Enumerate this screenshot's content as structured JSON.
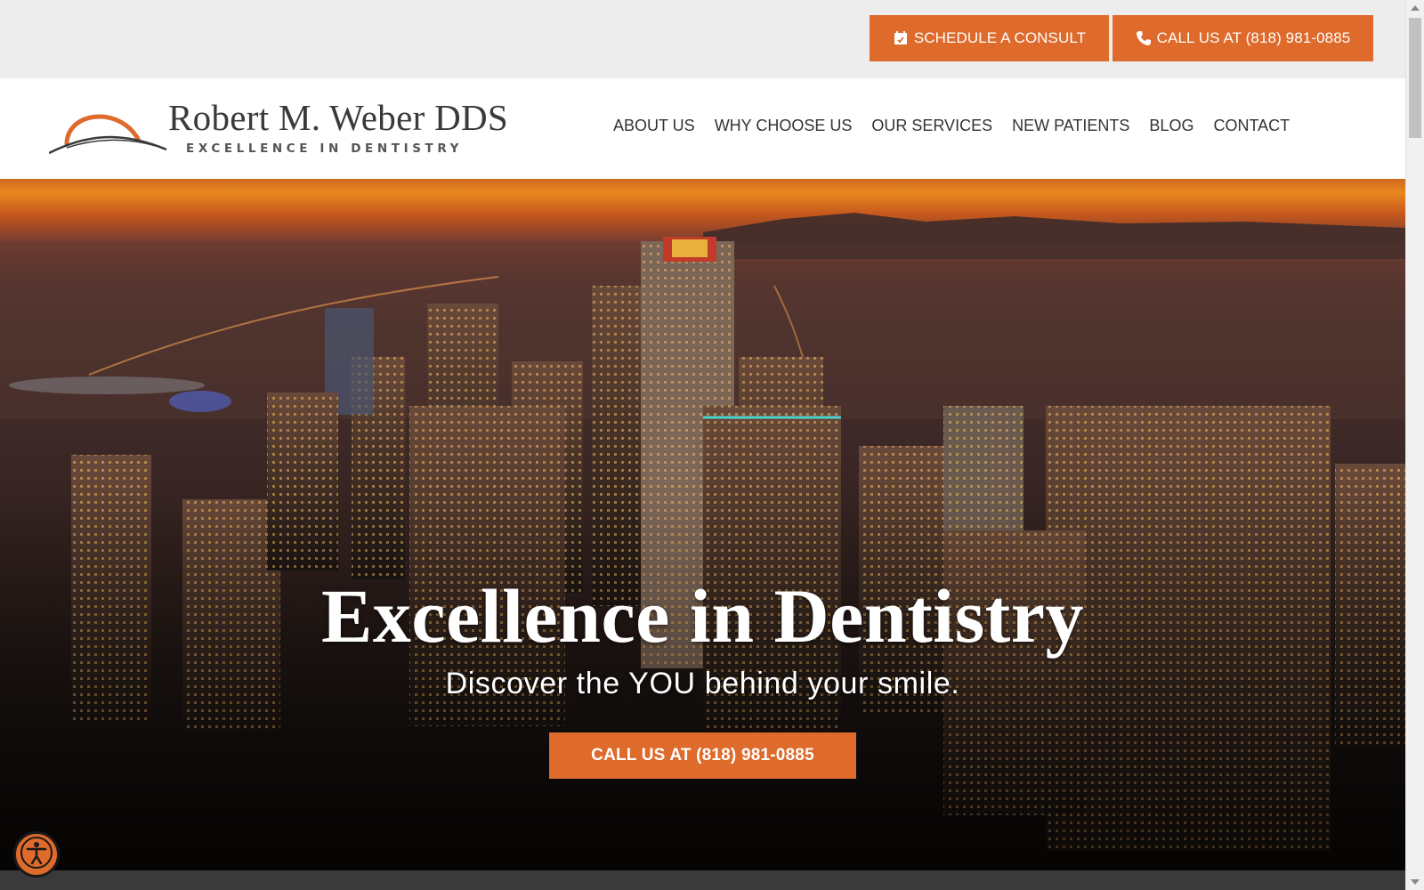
{
  "topbar": {
    "schedule_label": "SCHEDULE A CONSULT",
    "call_label": "CALL US AT (818) 981-0885"
  },
  "logo": {
    "name": "Robert M. Weber DDS",
    "tagline": "EXCELLENCE IN DENTISTRY"
  },
  "nav": {
    "items": [
      {
        "label": "ABOUT US"
      },
      {
        "label": "WHY CHOOSE US"
      },
      {
        "label": "OUR SERVICES"
      },
      {
        "label": "NEW PATIENTS"
      },
      {
        "label": "BLOG"
      },
      {
        "label": "CONTACT"
      }
    ]
  },
  "hero": {
    "title": "Excellence in Dentistry",
    "subtitle": "Discover the YOU behind your smile.",
    "cta_label": "CALL US AT (818) 981-0885"
  },
  "icons": {
    "schedule": "calendar-icon",
    "call": "phone-icon",
    "accessibility": "accessibility-icon",
    "logo_mark": "sunrise-arc-icon"
  },
  "colors": {
    "accent": "#de6a2b",
    "header_bg": "#ffffff",
    "topbar_bg": "#ededed",
    "text_dark": "#333333"
  }
}
